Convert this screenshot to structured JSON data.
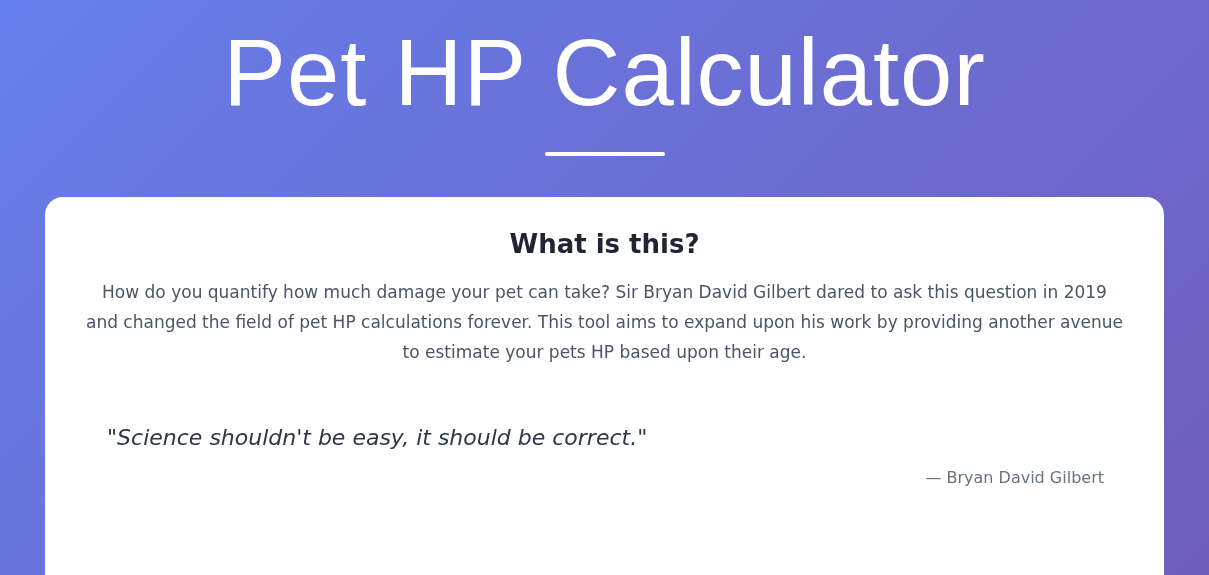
{
  "header": {
    "title": "Pet HP Calculator"
  },
  "about": {
    "heading": "What is this?",
    "body": "How do you quantify how much damage your pet can take? Sir Bryan David Gilbert dared to ask this question in 2019 and changed the field of pet HP calculations forever. This tool aims to expand upon his work by providing another avenue to estimate your pets HP based upon their age.",
    "quote": "\"Science shouldn't be easy, it should be correct.\"",
    "attribution": "— Bryan David Gilbert"
  }
}
